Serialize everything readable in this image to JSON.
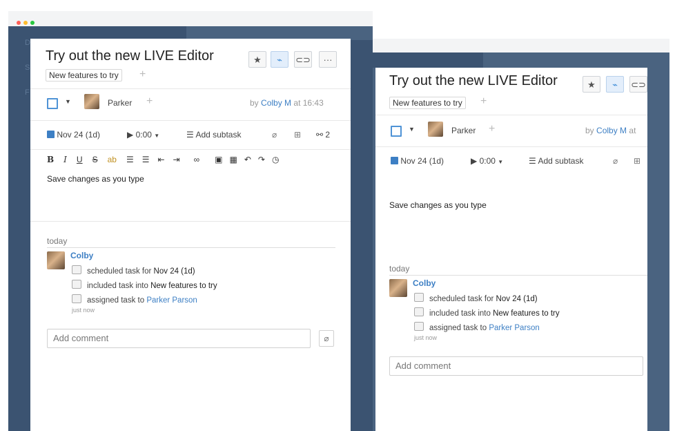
{
  "window_dots": [
    "#ff5f57",
    "#febc2e",
    "#28c840"
  ],
  "sidebar_letters": [
    "D",
    "S",
    "F",
    "c"
  ],
  "task": {
    "title": "Try out the new LIVE Editor",
    "folder_tag": "New features to try",
    "plus": "+",
    "assignee": "Parker",
    "by_prefix": "by",
    "author": "Colby M",
    "at_prefix": "at",
    "time": "16:43",
    "date_label": "Nov 24 (1d)",
    "timer_label": "0:00",
    "add_subtask": "Add subtask",
    "subtasks_count": "2",
    "toolbar_buttons": [
      "star-icon",
      "rss-icon",
      "link-icon",
      "more-icon"
    ],
    "rte_buttons": [
      "B",
      "I",
      "U",
      "S",
      "highlight",
      "ordered-list",
      "bullet-list",
      "outdent",
      "indent",
      "link",
      "image",
      "table",
      "undo",
      "redo",
      "history"
    ],
    "description": "Save changes as you type"
  },
  "stream": {
    "day": "today",
    "user": "Colby",
    "items": [
      {
        "prefix": "scheduled task for",
        "value": "Nov 24 (1d)"
      },
      {
        "prefix": "included task into",
        "value": "New features to try"
      },
      {
        "prefix": "assigned task to",
        "value": "Parker Parson"
      }
    ],
    "when": "just now"
  },
  "comment": {
    "placeholder": "Add comment"
  }
}
